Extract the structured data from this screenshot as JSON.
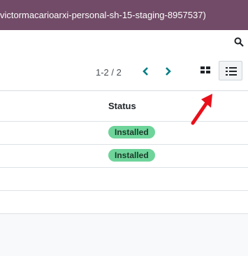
{
  "topbar": {
    "database_label": "victormacarioarxi-personal-sh-15-staging-8957537)"
  },
  "control_panel": {
    "pager": "1-2 / 2",
    "icons": {
      "search": "search-icon",
      "prev": "chevron-left-icon",
      "next": "chevron-right-icon",
      "kanban": "kanban-view-icon",
      "list": "list-view-icon"
    },
    "active_view": "list"
  },
  "table": {
    "columns": [
      "Status"
    ],
    "rows": [
      {
        "status": "Installed"
      },
      {
        "status": "Installed"
      }
    ]
  },
  "colors": {
    "brand": "#714b67",
    "accent": "#017e84",
    "badge_success": "#6ed49a",
    "annotation_arrow": "#e8101a"
  }
}
